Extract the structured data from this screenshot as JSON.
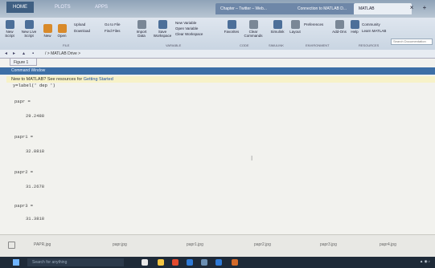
{
  "window": {
    "app_tabs": [
      "HOME",
      "PLOTS",
      "APPS"
    ],
    "browser_tabs": [
      "Chapter – Twitter – Web...",
      "Connection to MATLAB D...",
      "MATLAB"
    ]
  },
  "toolstrip": {
    "buttons": [
      {
        "label": "New\nScript",
        "icon": "new-script-icon"
      },
      {
        "label": "New\nLive Script",
        "icon": "live-script-icon"
      },
      {
        "label": "New",
        "icon": "new-icon"
      },
      {
        "label": "Open",
        "icon": "open-icon"
      },
      {
        "label": "Upload",
        "icon": "upload-icon"
      },
      {
        "label": "Download",
        "icon": "download-icon"
      },
      {
        "label": "Go to File",
        "icon": "goto-icon"
      },
      {
        "label": "Find Files",
        "icon": "find-icon"
      },
      {
        "label": "Import\nData",
        "icon": "import-icon"
      },
      {
        "label": "Save\nWorkspace",
        "icon": "save-ws-icon"
      },
      {
        "label": "New Variable",
        "icon": "new-var-icon"
      },
      {
        "label": "Open Variable",
        "icon": "open-var-icon"
      },
      {
        "label": "Clear Workspace",
        "icon": "clear-ws-icon"
      },
      {
        "label": "Favorites",
        "icon": "favorites-icon"
      },
      {
        "label": "Clear\nCommands",
        "icon": "clear-cmd-icon"
      },
      {
        "label": "Simulink",
        "icon": "simulink-icon"
      },
      {
        "label": "Layout",
        "icon": "layout-icon"
      },
      {
        "label": "Preferences",
        "icon": "prefs-icon"
      },
      {
        "label": "Add-Ons",
        "icon": "addons-icon"
      },
      {
        "label": "Help",
        "icon": "help-icon"
      },
      {
        "label": "Community",
        "icon": "community-icon"
      },
      {
        "label": "Learn MATLAB",
        "icon": "learn-icon"
      }
    ],
    "groups": [
      "FILE",
      "VARIABLE",
      "CODE",
      "SIMULINK",
      "ENVIRONMENT",
      "RESOURCES"
    ],
    "search_placeholder": "Search Documentation"
  },
  "address": {
    "path": "/  >  MATLAB Drive  >"
  },
  "figure_tab": "Figure 1",
  "command_window": {
    "title": "Command Window",
    "notice_prefix": "New to MATLAB? See resources for ",
    "notice_link": "Getting Started",
    "command": "y=label(' dep ')",
    "outputs": [
      {
        "name": "papr =",
        "value": "29.2488"
      },
      {
        "name": "papr1 =",
        "value": "32.8818"
      },
      {
        "name": "papr2 =",
        "value": "31.2678"
      },
      {
        "name": "papr3 =",
        "value": "31.3818"
      }
    ]
  },
  "statusbar": {
    "items": [
      "PAPR.jpg",
      "papr.jpg",
      "papr1.jpg",
      "papr2.jpg",
      "papr3.jpg",
      "papr4.jpg"
    ]
  },
  "taskbar": {
    "search_placeholder": "Search for anything"
  }
}
